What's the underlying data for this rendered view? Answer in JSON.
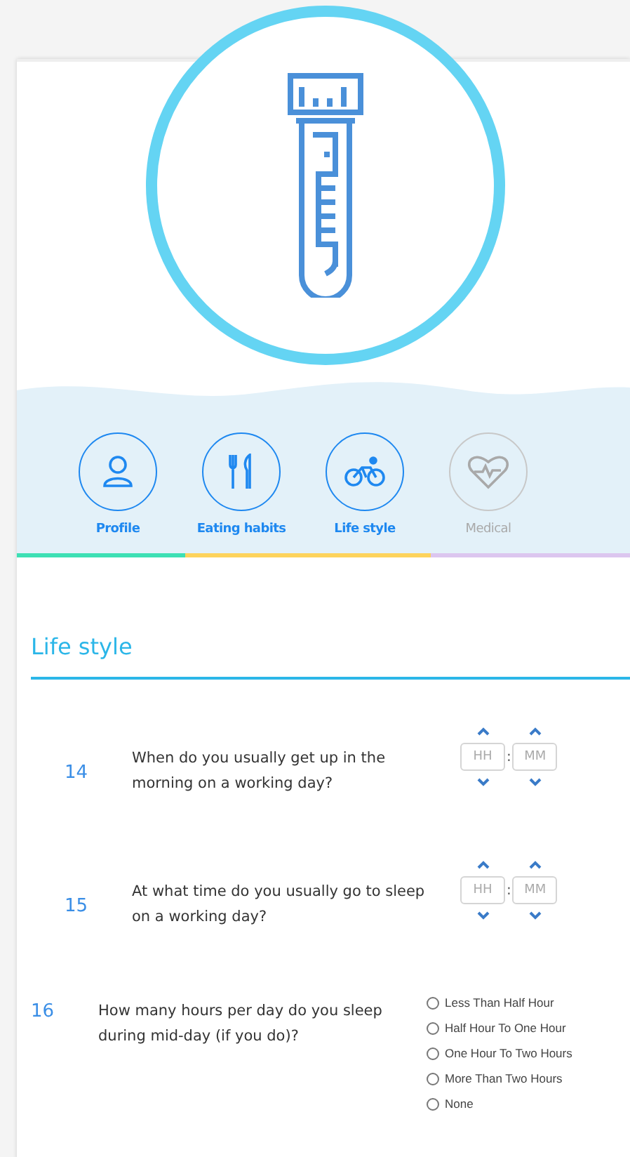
{
  "tabs": [
    {
      "label": "Profile",
      "active": true,
      "color": "#3de0b4"
    },
    {
      "label": "Eating habits",
      "active": true,
      "color": "#fdd35c"
    },
    {
      "label": "Life style",
      "active": true,
      "color": "#fdd35c"
    },
    {
      "label": "Medical",
      "active": false,
      "color": "#dcc6ef"
    }
  ],
  "section_title": "Life style",
  "questions": [
    {
      "number": "14",
      "text": "When do you usually get up in the morning on a working day?",
      "kind": "time",
      "hours_placeholder": "HH",
      "separator": ":",
      "minutes_placeholder": "MM"
    },
    {
      "number": "15",
      "text": "At what time do you usually go to sleep on a working day?",
      "kind": "time",
      "hours_placeholder": "HH",
      "separator": ":",
      "minutes_placeholder": "MM"
    },
    {
      "number": "16",
      "text": "How many hours per day do you sleep during mid-day (if you do)?",
      "kind": "choice",
      "options": [
        {
          "label": "Less Than Half Hour",
          "selected": false
        },
        {
          "label": "Half Hour To One Hour",
          "selected": false
        },
        {
          "label": "One Hour To Two Hours",
          "selected": false
        },
        {
          "label": "More Than Two Hours",
          "selected": false
        },
        {
          "label": "None",
          "selected": false
        }
      ]
    }
  ]
}
